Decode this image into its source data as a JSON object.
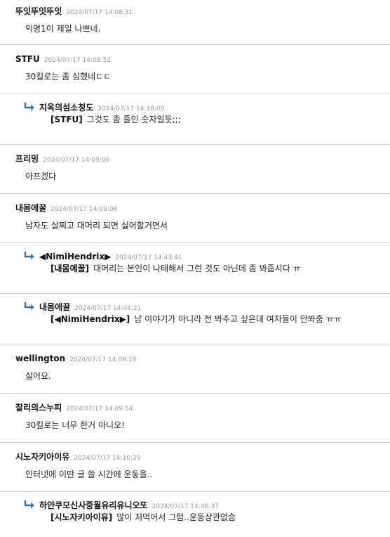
{
  "colors": {
    "divider": "#cfcfcf",
    "date": "#9a9a9a",
    "reply_arrow": "#2e6fb7"
  },
  "comments": [
    {
      "author": "뚜잇뚜잇뚜잇",
      "date": "2024/07/17 14:08:31",
      "text": "익명1이 제일 나쁘네."
    },
    {
      "author": "STFU",
      "date": "2024/07/17 14:08:52",
      "text": "30킬로는 좀 심했네ㄷㄷ"
    },
    {
      "reply": true,
      "author": "지옥의섬소청도",
      "date": "2024/07/17 14:18:00",
      "mention": "[STFU]",
      "text": "그것도 좀 줄인 숫자일듯;;;"
    },
    {
      "author": "프리밍",
      "date": "2024/07/17 14:09:06",
      "text": "아프겠다"
    },
    {
      "author": "내몸에꿀",
      "date": "2024/07/17 14:09:08",
      "text": "남자도 살찌고 대머리 되면 싫어할거면서"
    },
    {
      "reply": true,
      "author": "◀NimiHendrix▶",
      "date": "2024/07/17 14:43:41",
      "mention": "[내몸에꿀]",
      "text": "대머리는 본인이 나태해서 그런 것도 아닌데 좀 봐줍시다 ㅠ"
    },
    {
      "reply": true,
      "author": "내몸에꿀",
      "date": "2024/07/17 14:44:21",
      "mention": "[◀NimiHendrix▶]",
      "text": "남 이야기가 아니라 전 봐주고 싶은데 여자들이 안봐줌 ㅠㅠ"
    },
    {
      "author": "wellington",
      "date": "2024/07/17 14:09:19",
      "text": "싫어요."
    },
    {
      "author": "찰리의스누피",
      "date": "2024/07/17 14:09:54",
      "text": "30킬로는 너무 한거 아니오!"
    },
    {
      "author": "시노자키아이유",
      "date": "2024/07/17 14:10:29",
      "text": "인터넷에 이딴 글 쓸 시간에 운동을.."
    },
    {
      "reply": true,
      "author": "하얀쿠모신사중월유리유니오또",
      "date": "2024/07/17 14:46:37",
      "mention": "[시노자키아이유]",
      "text": "많이 처먹어서 그럼..운동상관없슴"
    }
  ]
}
